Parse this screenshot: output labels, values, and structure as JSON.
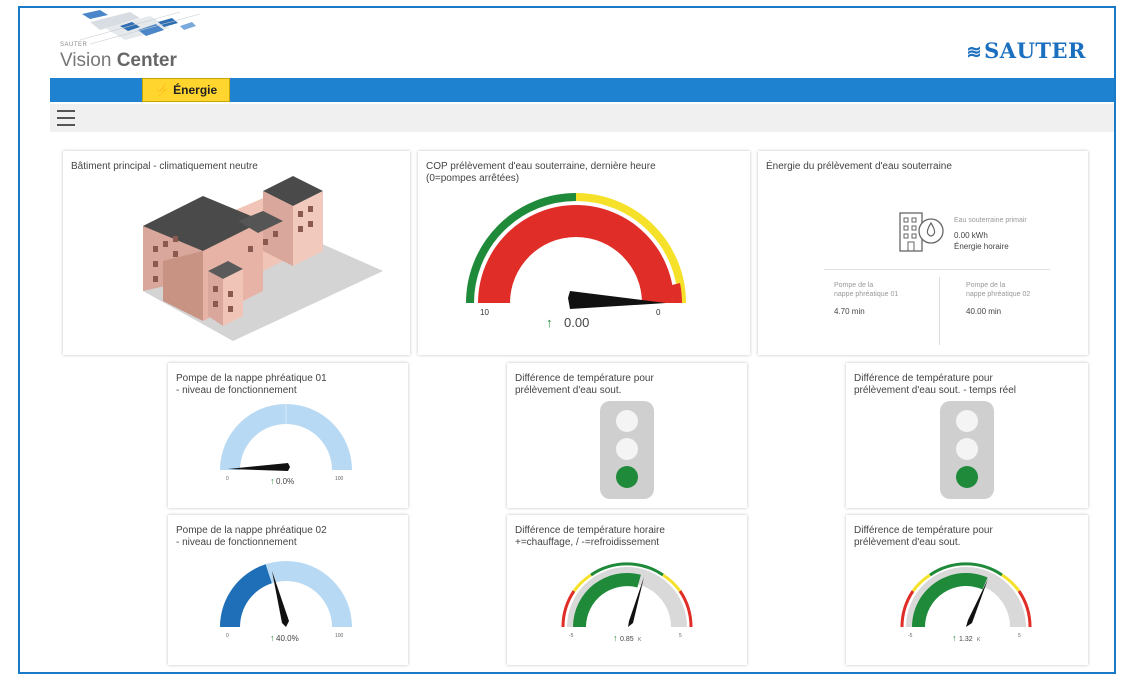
{
  "header": {
    "logo_small": "SAUTER",
    "logo_title_light": "Vision ",
    "logo_title_bold": "Center",
    "brand": "SAUTER"
  },
  "nav": {
    "tab_label": "Énergie"
  },
  "colors": {
    "nav_blue": "#1f82d0",
    "tab_yellow": "#ffd52e",
    "gauge_red": "#e02d27",
    "gauge_green": "#1f8a3a",
    "gauge_yellow": "#f5e12a",
    "light_blue": "#b8d9f3",
    "dark_blue": "#1f6fb8"
  },
  "cards": {
    "building": {
      "title": "Bâtiment principal - climatiquement neutre"
    },
    "cop": {
      "title": "COP prélèvement d'eau souterraine, dernière heure\n(0=pompes arrêtées)",
      "value": "0.00",
      "min": "10",
      "max": "0"
    },
    "energy": {
      "title": "Énergie du prélèvement d'eau souterraine",
      "primary_label": "Eau souterraine primair",
      "primary_value": "0.00 kWh",
      "primary_sub": "Énergie horaire",
      "pump1_label": "Pompe de la\nnappe phréatique 01",
      "pump1_value": "4.70 min",
      "pump2_label": "Pompe de la\nnappe phréatique 02",
      "pump2_value": "40.00 min"
    },
    "pump1": {
      "title": "Pompe de la nappe phréatique 01\n- niveau de fonctionnement",
      "value": "0.0%",
      "level": 0.0,
      "min": "0",
      "max": "100"
    },
    "tempdiff1": {
      "title": "Différence de température pour\nprélèvement d'eau sout."
    },
    "tempdiff2": {
      "title": "Différence de température pour\nprélèvement d'eau sout. - temps réel"
    },
    "pump2": {
      "title": "Pompe de la nappe phréatique 02\n- niveau de fonctionnement",
      "value": "40.0%",
      "level": 0.4,
      "min": "0",
      "max": "100"
    },
    "hourly": {
      "title": "Différence de température horaire\n+=chauffage, / -=refroidissement",
      "value": "0.85",
      "unit": "K",
      "min": "-5",
      "max": "5"
    },
    "tempdiff3": {
      "title": "Différence de température pour\nprélèvement d'eau sout.",
      "value": "1.32",
      "unit": "K",
      "min": "-5",
      "max": "5"
    }
  }
}
